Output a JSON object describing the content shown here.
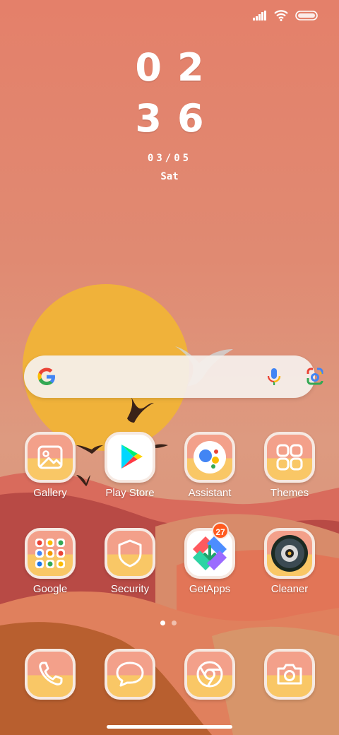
{
  "status_bar": {
    "icons": [
      "signal-icon",
      "wifi-icon",
      "battery-icon"
    ]
  },
  "clock": {
    "hours": "02",
    "minutes": "36",
    "date": "03/05",
    "day": "Sat"
  },
  "search_bar": {
    "icons": [
      "google-g-icon",
      "microphone-icon",
      "google-lens-icon"
    ]
  },
  "apps": [
    {
      "label": "Gallery"
    },
    {
      "label": "Play Store"
    },
    {
      "label": "Assistant"
    },
    {
      "label": "Themes"
    },
    {
      "label": "Google"
    },
    {
      "label": "Security"
    },
    {
      "label": "GetApps",
      "badge": "27"
    },
    {
      "label": "Cleaner"
    }
  ],
  "dock": [
    {
      "icon": "phone-icon"
    },
    {
      "icon": "messages-icon"
    },
    {
      "icon": "browser-icon"
    },
    {
      "icon": "camera-icon"
    }
  ],
  "page_indicator": {
    "pages": 2,
    "current": 1
  },
  "colors": {
    "sky": "#e4806a",
    "sun": "#f0b23a",
    "icon_top": "#f3a08a",
    "icon_bottom": "#f9c766",
    "badge": "#ff5a1f"
  }
}
